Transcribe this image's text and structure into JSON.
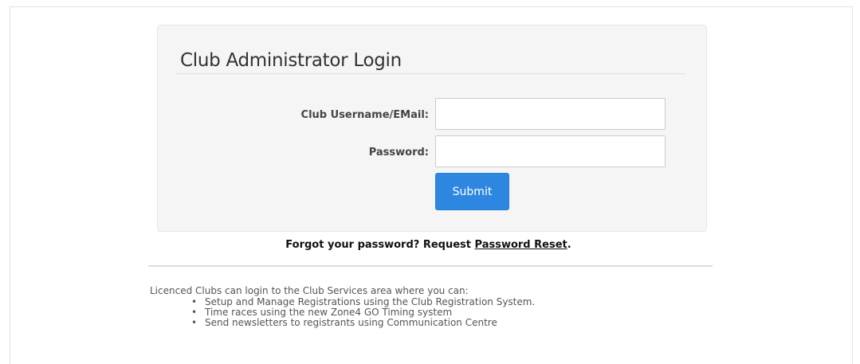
{
  "login": {
    "title": "Club Administrator Login",
    "username_label": "Club Username/EMail:",
    "username_value": "",
    "password_label": "Password:",
    "password_value": "",
    "submit_label": "Submit"
  },
  "forgot": {
    "prefix": "Forgot your password? Request ",
    "link_label": "Password Reset",
    "suffix": "."
  },
  "info": {
    "intro": "Licenced Clubs can login to the Club Services area where you can:",
    "items": [
      "Setup and Manage Registrations using the Club Registration System.",
      "Time races using the new Zone4 GO Timing system",
      "Send newsletters to registrants using Communication Centre"
    ]
  },
  "colors": {
    "panel_bg": "#f5f5f5",
    "submit_bg": "#2d86e0"
  }
}
